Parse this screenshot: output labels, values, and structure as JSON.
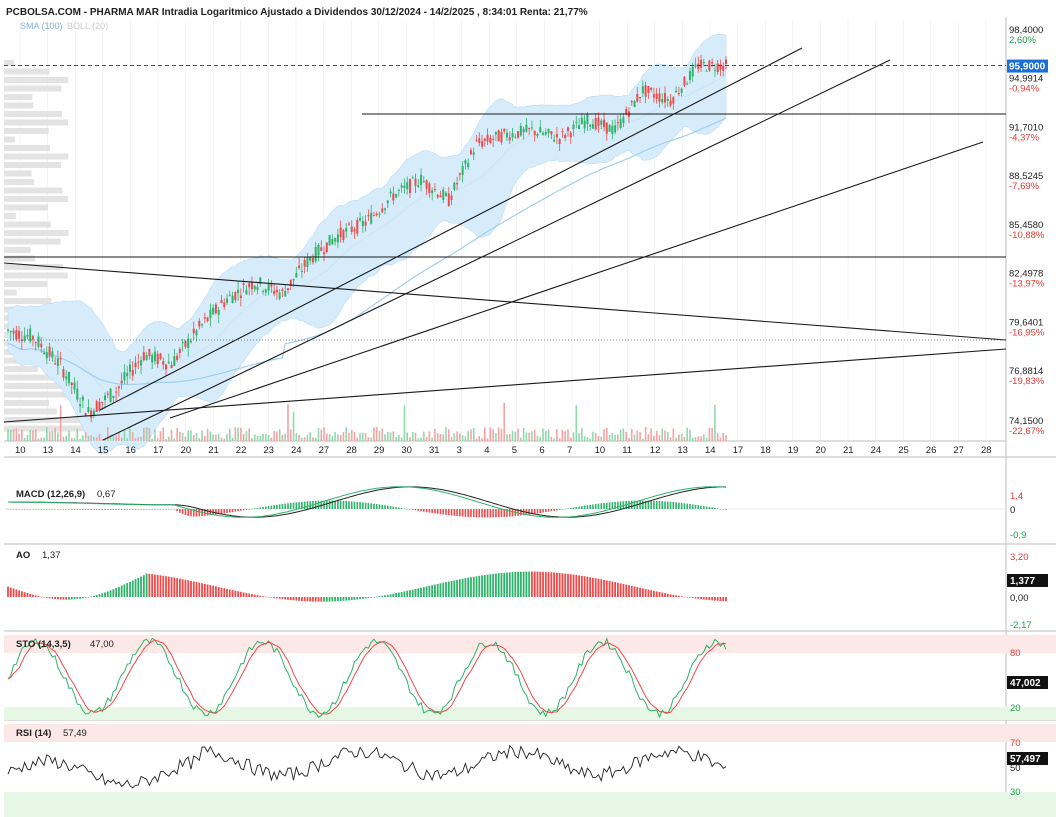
{
  "header": {
    "title": "PCBOLSA.COM - PHARMA MAR Intradia Logaritmico Ajustado a Dividendos 30/12/2024 - 14/2/2025 , 8:34:01 Renta: 21,77%",
    "indicators_sma": "SMA (100)",
    "indicators_boll": "BOLL (20)"
  },
  "colors": {
    "up": "#2db36a",
    "down": "#ef4a4a",
    "boll_fill": "#d7ecfb",
    "sma": "#9fd0f0",
    "grid": "#e8e8e8",
    "badge": "#1a6fd6",
    "macd_fill": "#e58d8d"
  },
  "price_axis": {
    "levels": [
      {
        "price": "98,4000",
        "pct": "2,60%",
        "pct_color": "green",
        "v": 98.4
      },
      {
        "price": "94,9914",
        "pct": "-0,94%",
        "pct_color": "red",
        "v": 94.9914
      },
      {
        "price": "91,7010",
        "pct": "-4,37%",
        "pct_color": "red",
        "v": 91.701
      },
      {
        "price": "88,5245",
        "pct": "-7,69%",
        "pct_color": "red",
        "v": 88.5245
      },
      {
        "price": "85,4580",
        "pct": "-10,88%",
        "pct_color": "red",
        "v": 85.458
      },
      {
        "price": "82,4978",
        "pct": "-13,97%",
        "pct_color": "red",
        "v": 82.4978
      },
      {
        "price": "79,6401",
        "pct": "-16,95%",
        "pct_color": "red",
        "v": 79.6401
      },
      {
        "price": "76,8814",
        "pct": "-19,83%",
        "pct_color": "red",
        "v": 76.8814
      },
      {
        "price": "74,1500",
        "pct": "-22,67%",
        "pct_color": "red",
        "v": 74.15
      }
    ],
    "current_badge": "95,9000",
    "current_value": 95.9
  },
  "x_axis": {
    "labels": [
      "10",
      "13",
      "14",
      "15",
      "16",
      "17",
      "20",
      "21",
      "22",
      "23",
      "24",
      "27",
      "28",
      "29",
      "30",
      "31",
      "3",
      "4",
      "5",
      "6",
      "7",
      "10",
      "11",
      "12",
      "13",
      "14",
      "17",
      "18",
      "19",
      "20",
      "21",
      "24",
      "25",
      "26",
      "27",
      "28"
    ]
  },
  "panels": {
    "macd": {
      "label": "MACD (12,26,9)",
      "value": "0,67",
      "levels": [
        "1,4",
        "0",
        "-0,9"
      ]
    },
    "ao": {
      "label": "AO",
      "value": "1,37",
      "levels": [
        "3,20",
        "0,00",
        "-2,17"
      ],
      "badge": "1,377"
    },
    "sto": {
      "label": "STO (14,3,5)",
      "value": "47,00",
      "levels": [
        "80",
        "20"
      ],
      "badge": "47,002"
    },
    "rsi": {
      "label": "RSI (14)",
      "value": "57,49",
      "levels": [
        "70",
        "50",
        "30"
      ],
      "badge": "57,497"
    }
  },
  "chart_data": {
    "type": "candlestick",
    "title": "PCBOLSA.COM - PHARMA MAR Intradia Logaritmico Ajustado a Dividendos 30/12/2024 - 14/2/2025 , 8:34:01 Renta: 21,77%",
    "y_scale": "log",
    "ylim": [
      73.5,
      99.5
    ],
    "last_price": 95.9,
    "sessions": [
      {
        "date": "10",
        "close": 78.8
      },
      {
        "date": "13",
        "close": 77.2
      },
      {
        "date": "14",
        "close": 74.6
      },
      {
        "date": "15",
        "close": 75.8
      },
      {
        "date": "16",
        "close": 77.8
      },
      {
        "date": "17",
        "close": 77.3
      },
      {
        "date": "20",
        "close": 79.3
      },
      {
        "date": "21",
        "close": 81.0
      },
      {
        "date": "22",
        "close": 82.0
      },
      {
        "date": "23",
        "close": 81.3
      },
      {
        "date": "24",
        "close": 83.4
      },
      {
        "date": "27",
        "close": 84.8
      },
      {
        "date": "28",
        "close": 85.6
      },
      {
        "date": "29",
        "close": 87.3
      },
      {
        "date": "30",
        "close": 88.3
      },
      {
        "date": "31",
        "close": 87.0
      },
      {
        "date": "3",
        "close": 90.6
      },
      {
        "date": "4",
        "close": 91.2
      },
      {
        "date": "5",
        "close": 91.5
      },
      {
        "date": "6",
        "close": 91.0
      },
      {
        "date": "7",
        "close": 92.2
      },
      {
        "date": "10",
        "close": 91.5
      },
      {
        "date": "11",
        "close": 94.2
      },
      {
        "date": "12",
        "close": 93.5
      },
      {
        "date": "13",
        "close": 95.9
      },
      {
        "date": "14",
        "close": 95.9
      }
    ],
    "horizontal_levels": [
      92.5,
      83.3,
      79.0
    ],
    "macd_range": [
      -0.9,
      1.4
    ],
    "ao_range": [
      -2.17,
      3.2
    ],
    "sto_levels": [
      80,
      20
    ],
    "rsi_levels": [
      70,
      30
    ]
  }
}
